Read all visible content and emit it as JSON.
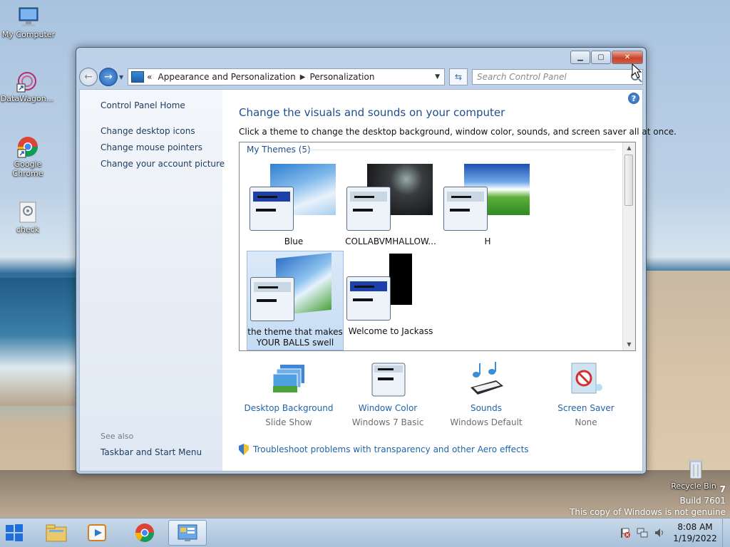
{
  "desktop": {
    "icons": [
      {
        "label": "My Computer"
      },
      {
        "label": "DataWagon..."
      },
      {
        "label": "Google Chrome"
      },
      {
        "label": "check"
      },
      {
        "label": "Recycle Bin"
      }
    ],
    "watermark": {
      "line1": "7",
      "line2": "Build 7601",
      "line3": "This copy of Windows is not genuine"
    }
  },
  "window": {
    "address": {
      "prefix": "«",
      "crumbs": [
        "Appearance and Personalization",
        "Personalization"
      ]
    },
    "search": {
      "placeholder": "Search Control Panel"
    },
    "left_pane": {
      "home": "Control Panel Home",
      "links": [
        "Change desktop icons",
        "Change mouse pointers",
        "Change your account picture"
      ],
      "see_also": "See also",
      "see_also_links": [
        "Taskbar and Start Menu"
      ]
    },
    "title": "Change the visuals and sounds on your computer",
    "subtitle": "Click a theme to change the desktop background, window color, sounds, and screen saver all at once.",
    "themes_group": "My Themes (5)",
    "themes": [
      {
        "label": "Blue"
      },
      {
        "label": "COLLABVMHALLOW..."
      },
      {
        "label": "H"
      },
      {
        "label_line1": "the theme that makes",
        "label_line2": "YOUR BALLS swell"
      },
      {
        "label": "Welcome to Jackass"
      }
    ],
    "bottom": [
      {
        "label": "Desktop Background",
        "value": "Slide Show"
      },
      {
        "label": "Window Color",
        "value": "Windows 7 Basic"
      },
      {
        "label": "Sounds",
        "value": "Windows Default"
      },
      {
        "label": "Screen Saver",
        "value": "None"
      }
    ],
    "troubleshoot": "Troubleshoot problems with transparency and other Aero effects"
  },
  "taskbar": {
    "time": "8:08 AM",
    "date": "1/19/2022"
  }
}
